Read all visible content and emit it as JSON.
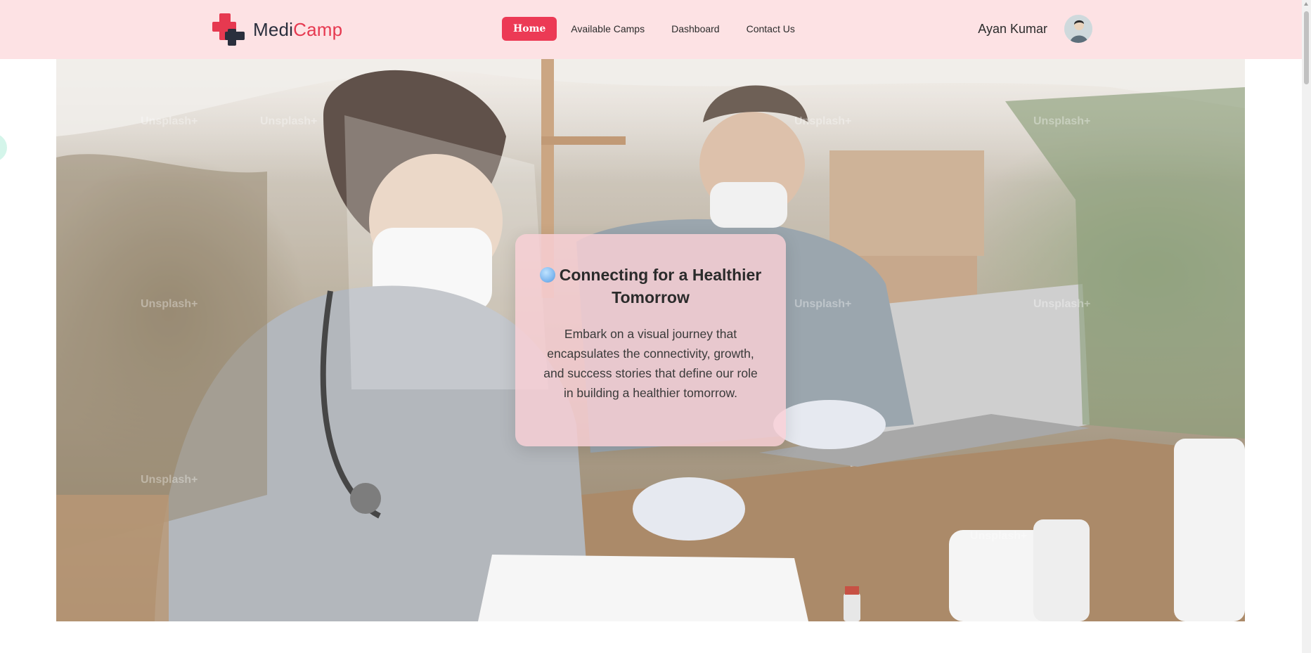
{
  "brand": {
    "part1": "Medi",
    "part2": "Camp",
    "accent": "#e63950",
    "dark": "#2a2f3d"
  },
  "nav": {
    "items": [
      {
        "label": "Home",
        "active": true
      },
      {
        "label": "Available Camps",
        "active": false
      },
      {
        "label": "Dashboard",
        "active": false
      },
      {
        "label": "Contact Us",
        "active": false
      }
    ],
    "active_color": "#ec3a55"
  },
  "user": {
    "name": "Ayan Kumar",
    "avatar_icon": "user-avatar"
  },
  "hero": {
    "title": "Connecting for a Healthier Tomorrow",
    "title_icon": "globe-icon",
    "text": "Embark on a visual journey that encapsulates the connectivity, growth, and success stories that define our role in building a healthier tomorrow.",
    "watermark": "Unsplash+"
  },
  "colors": {
    "navbar_bg": "#fde2e4",
    "card_bg": "#f9d0d6"
  }
}
